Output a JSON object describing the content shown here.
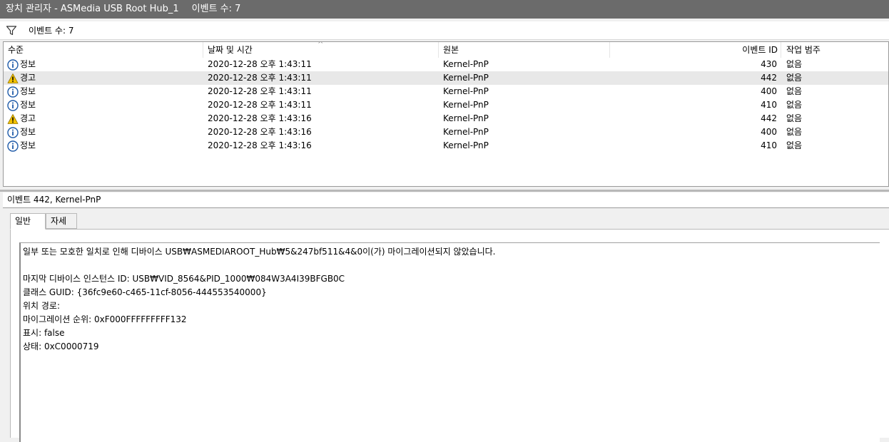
{
  "window": {
    "title": "장치 관리자 - ASMedia USB Root Hub_1",
    "event_count": "이벤트 수: 7"
  },
  "toolbar": {
    "filter_icon": "filter-icon",
    "event_count": "이벤트 수: 7"
  },
  "grid": {
    "columns": [
      "수준",
      "날짜 및 시간",
      "원본",
      "이벤트 ID",
      "작업 범주"
    ],
    "rows": [
      {
        "level": "정보",
        "icon": "info-icon",
        "datetime": "2020-12-28 오후 1:43:11",
        "source": "Kernel-PnP",
        "id": "430",
        "category": "없음"
      },
      {
        "level": "경고",
        "icon": "warning-icon",
        "datetime": "2020-12-28 오후 1:43:11",
        "source": "Kernel-PnP",
        "id": "442",
        "category": "없음"
      },
      {
        "level": "정보",
        "icon": "info-icon",
        "datetime": "2020-12-28 오후 1:43:11",
        "source": "Kernel-PnP",
        "id": "400",
        "category": "없음"
      },
      {
        "level": "정보",
        "icon": "info-icon",
        "datetime": "2020-12-28 오후 1:43:11",
        "source": "Kernel-PnP",
        "id": "410",
        "category": "없음"
      },
      {
        "level": "경고",
        "icon": "warning-icon",
        "datetime": "2020-12-28 오후 1:43:16",
        "source": "Kernel-PnP",
        "id": "442",
        "category": "없음"
      },
      {
        "level": "정보",
        "icon": "info-icon",
        "datetime": "2020-12-28 오후 1:43:16",
        "source": "Kernel-PnP",
        "id": "400",
        "category": "없음"
      },
      {
        "level": "정보",
        "icon": "info-icon",
        "datetime": "2020-12-28 오후 1:43:16",
        "source": "Kernel-PnP",
        "id": "410",
        "category": "없음"
      }
    ]
  },
  "detail": {
    "header": "이벤트 442, Kernel-PnP",
    "tabs": [
      "일반",
      "자세히"
    ],
    "message": {
      "line1": "일부 또는 모호한 일치로 인해 디바이스 USB₩ASMEDIAROOT_Hub₩5&247bf511&4&0이(가) 마이그레이션되지 않았습니다.",
      "line2": "마지막 디바이스 인스턴스 ID: USB₩VID_8564&PID_1000₩084W3A4I39BFGB0C",
      "line3": "클래스 GUID: {36fc9e60-c465-11cf-8056-444553540000}",
      "line4": "위치 경로:",
      "line5": "마이그레이션 순위: 0xF000FFFFFFFFF132",
      "line6": "표시: false",
      "line7": "상태: 0xC0000719"
    }
  },
  "colors": {
    "titlebar": "#6b6b6b",
    "selected_row": "#e8e8e8",
    "info_icon": "#1e5aa8",
    "warning_icon": "#f2c200"
  }
}
